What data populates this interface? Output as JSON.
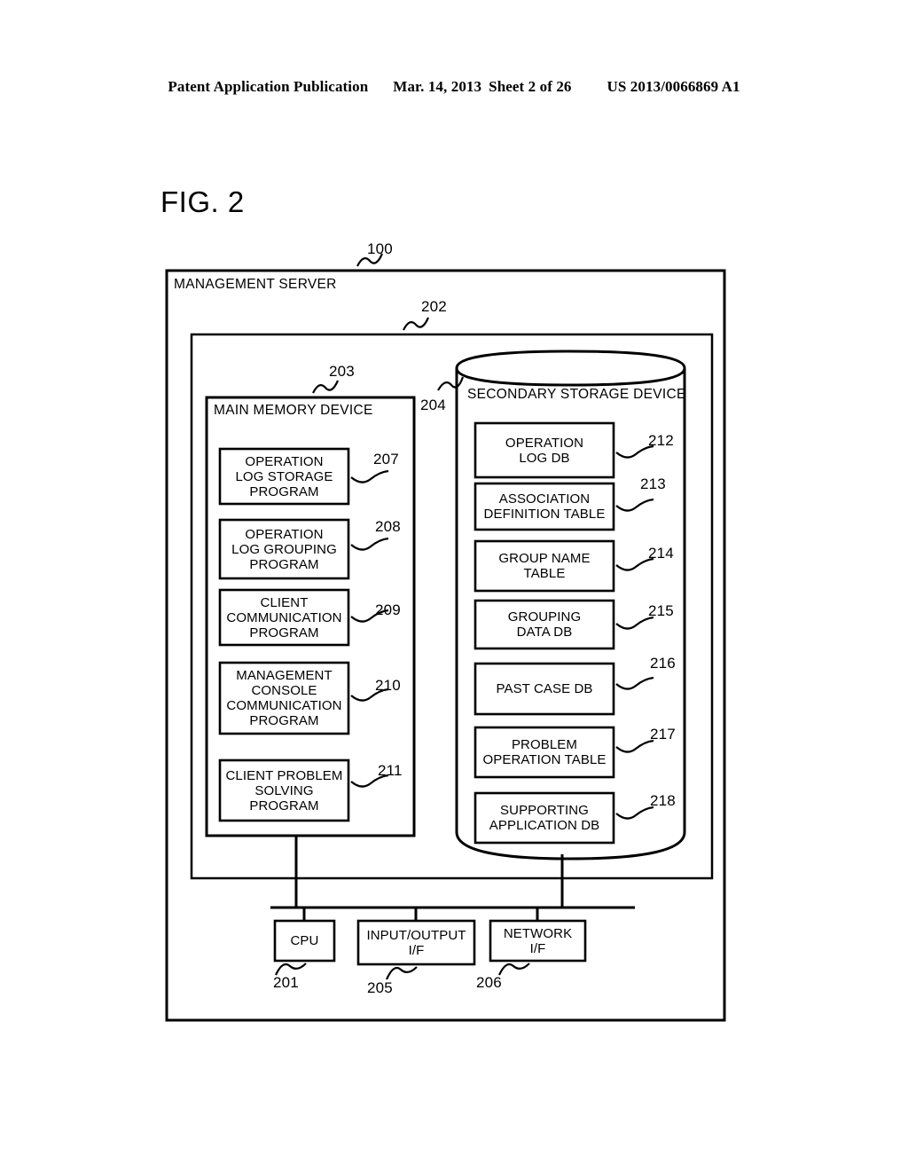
{
  "page_header": {
    "publication": "Patent Application Publication",
    "date": "Mar. 14, 2013",
    "sheet": "Sheet 2 of 26",
    "patent_number": "US 2013/0066869 A1"
  },
  "figure": {
    "title": "FIG. 2",
    "outer": {
      "label": "MANAGEMENT SERVER",
      "ref": "100"
    },
    "inner": {
      "ref": "202"
    },
    "main_memory": {
      "label": "MAIN MEMORY DEVICE",
      "ref": "203",
      "modules": [
        {
          "label": "OPERATION\nLOG STORAGE\nPROGRAM",
          "ref": "207"
        },
        {
          "label": "OPERATION\nLOG GROUPING\nPROGRAM",
          "ref": "208"
        },
        {
          "label": "CLIENT\nCOMMUNICATION\nPROGRAM",
          "ref": "209"
        },
        {
          "label": "MANAGEMENT\nCONSOLE\nCOMMUNICATION\nPROGRAM",
          "ref": "210"
        },
        {
          "label": "CLIENT PROBLEM\nSOLVING\nPROGRAM",
          "ref": "211"
        }
      ]
    },
    "secondary_storage": {
      "label": "SECONDARY STORAGE DEVICE",
      "ref": "204",
      "stores": [
        {
          "label": "OPERATION\nLOG DB",
          "ref": "212"
        },
        {
          "label": "ASSOCIATION\nDEFINITION TABLE",
          "ref": "213"
        },
        {
          "label": "GROUP NAME\nTABLE",
          "ref": "214"
        },
        {
          "label": "GROUPING\nDATA DB",
          "ref": "215"
        },
        {
          "label": "PAST CASE DB",
          "ref": "216"
        },
        {
          "label": "PROBLEM\nOPERATION TABLE",
          "ref": "217"
        },
        {
          "label": "SUPPORTING\nAPPLICATION DB",
          "ref": "218"
        }
      ]
    },
    "peripherals": [
      {
        "label": "CPU",
        "ref": "201"
      },
      {
        "label": "INPUT/OUTPUT\nI/F",
        "ref": "205"
      },
      {
        "label": "NETWORK\nI/F",
        "ref": "206"
      }
    ]
  }
}
